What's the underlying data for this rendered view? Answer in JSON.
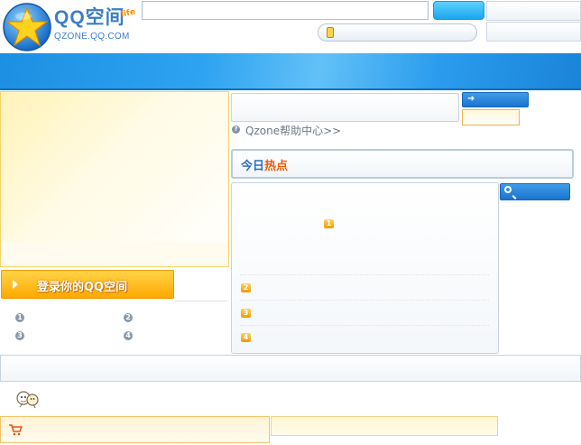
{
  "header": {
    "logo_text": "QQ空间",
    "logo_badge": "life",
    "logo_url": "QZONE.QQ.COM",
    "search_value": "",
    "search_button_label": ""
  },
  "login": {
    "label": "登录你的QQ空间",
    "steps": [
      "1",
      "2",
      "3",
      "4"
    ]
  },
  "help": {
    "icon_glyph": "?",
    "link_text": "Qzone帮助中心>>"
  },
  "hot": {
    "title_part1": "今日",
    "title_part2": "热点",
    "ranks": [
      "1",
      "2",
      "3",
      "4"
    ]
  },
  "icons": {
    "logo": "star-logo-icon",
    "mobile": "mobile-phone-icon",
    "arrow": "right-arrow-icon",
    "search": "magnifier-icon",
    "mascot": "mascot-icon",
    "cart": "shopping-cart-icon"
  },
  "colors": {
    "brand_blue": "#2ea3f0",
    "accent_orange": "#ffa800",
    "hot_red": "#f25a00"
  }
}
